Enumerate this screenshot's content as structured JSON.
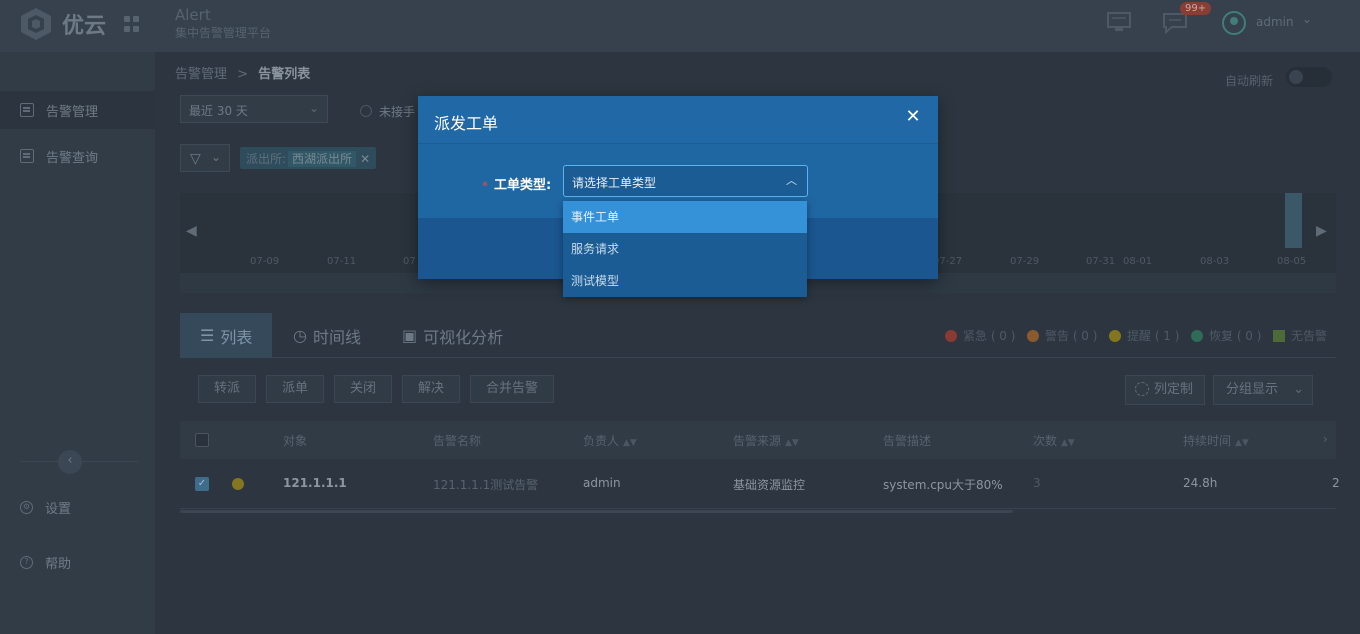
{
  "header": {
    "brand": "优云",
    "app_title": "Alert",
    "app_subtitle": "集中告警管理平台",
    "badge": "99+",
    "username": "admin",
    "icons": [
      "monitor-icon",
      "message-icon",
      "user-avatar-icon",
      "grid-menu-icon"
    ]
  },
  "sidebar": {
    "items": [
      {
        "label": "告警管理",
        "icon": "document-icon",
        "active": true
      },
      {
        "label": "告警查询",
        "icon": "document-icon",
        "active": false
      }
    ],
    "bottom": [
      {
        "label": "设置",
        "icon": "gear-icon"
      },
      {
        "label": "帮助",
        "icon": "help-icon"
      }
    ]
  },
  "breadcrumb": {
    "parent": "告警管理",
    "separator": ">",
    "current": "告警列表"
  },
  "auto_refresh_label": "自动刷新",
  "time_range": "最近 30 天",
  "radio_label": "未接手",
  "filter": {
    "tag_key": "派出所:",
    "tag_value": "西湖派出所"
  },
  "timeline": {
    "ticks": [
      "07-09",
      "07-11",
      "07",
      "07-27",
      "07-29",
      "07-31",
      "08-01",
      "08-03",
      "08-05"
    ]
  },
  "tabs": [
    {
      "label": "列表",
      "icon": "list-icon",
      "active": true
    },
    {
      "label": "时间线",
      "icon": "clock-icon",
      "active": false
    },
    {
      "label": "可视化分析",
      "icon": "chart-icon",
      "active": false
    }
  ],
  "legend": [
    {
      "label": "紧急 ( 0 )",
      "color": "#8a3b31"
    },
    {
      "label": "警告 ( 0 )",
      "color": "#8a5a2c"
    },
    {
      "label": "提醒 ( 1 )",
      "color": "#84761f"
    },
    {
      "label": "恢复 ( 0 )",
      "color": "#2f6b57"
    },
    {
      "label": "无告警",
      "color": "#4c6b37"
    }
  ],
  "actions": [
    "转派",
    "派单",
    "关闭",
    "解决",
    "合并告警"
  ],
  "column_custom_label": "列定制",
  "group_display_label": "分组显示",
  "table": {
    "headers": [
      "对象",
      "告警名称",
      "负责人",
      "告警来源",
      "告警描述",
      "次数",
      "持续时间"
    ],
    "rows": [
      {
        "object": "121.1.1.1",
        "name": "121.1.1.1测试告警",
        "owner": "admin",
        "source": "基础资源监控",
        "desc": "system.cpu大于80%",
        "count": "3",
        "duration": "24.8h",
        "extra": "2"
      }
    ]
  },
  "modal": {
    "title": "派发工单",
    "required_mark": "*",
    "field_label": "工单类型:",
    "select_placeholder": "请选择工单类型",
    "options": [
      "事件工单",
      "服务请求",
      "测试模型"
    ],
    "highlighted_option": 0
  }
}
